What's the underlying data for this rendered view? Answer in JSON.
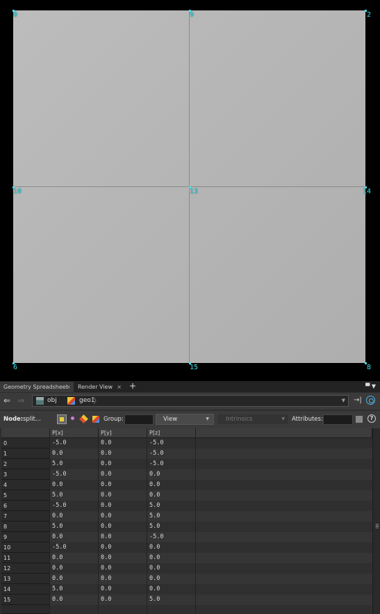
{
  "viewport": {
    "vertex_labels": [
      "0",
      "9",
      "2",
      "10",
      "13",
      "14",
      "6",
      "15",
      "8"
    ]
  },
  "tabs": [
    {
      "label": "Geometry Spreadsheet",
      "close": "×"
    },
    {
      "label": "Render View",
      "close": "×"
    }
  ],
  "add_tab": "+",
  "pane_menu": "▀ ▼",
  "path": {
    "items": [
      "obj",
      "geo1"
    ],
    "dropdown": "▼"
  },
  "toolbar": {
    "node_label": "Node:",
    "node_value": "split...",
    "group_label": "Group:",
    "view_label": "View",
    "intrinsics_label": "Intrinsics",
    "attributes_label": "Attributes:",
    "help": "?"
  },
  "table": {
    "columns": [
      "",
      "P[x]",
      "P[y]",
      "P[z]"
    ],
    "rows": [
      [
        "0",
        "-5.0",
        "0.0",
        "-5.0"
      ],
      [
        "1",
        "0.0",
        "0.0",
        "-5.0"
      ],
      [
        "2",
        "5.0",
        "0.0",
        "-5.0"
      ],
      [
        "3",
        "-5.0",
        "0.0",
        "0.0"
      ],
      [
        "4",
        "0.0",
        "0.0",
        "0.0"
      ],
      [
        "5",
        "5.0",
        "0.0",
        "0.0"
      ],
      [
        "6",
        "-5.0",
        "0.0",
        "5.0"
      ],
      [
        "7",
        "0.0",
        "0.0",
        "5.0"
      ],
      [
        "8",
        "5.0",
        "0.0",
        "5.0"
      ],
      [
        "9",
        "0.0",
        "0.0",
        "-5.0"
      ],
      [
        "10",
        "-5.0",
        "0.0",
        "0.0"
      ],
      [
        "11",
        "0.0",
        "0.0",
        "0.0"
      ],
      [
        "12",
        "0.0",
        "0.0",
        "0.0"
      ],
      [
        "13",
        "0.0",
        "0.0",
        "0.0"
      ],
      [
        "14",
        "5.0",
        "0.0",
        "0.0"
      ],
      [
        "15",
        "0.0",
        "0.0",
        "5.0"
      ]
    ]
  }
}
